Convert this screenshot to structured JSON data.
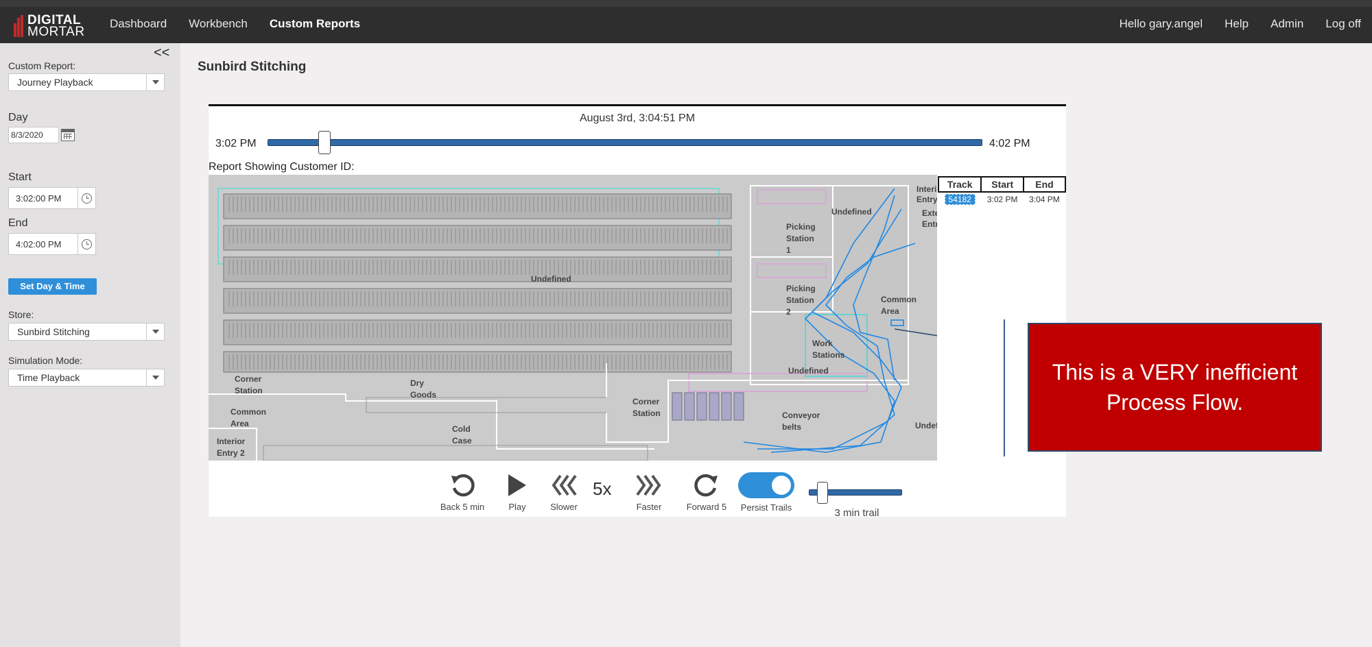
{
  "brand": {
    "line1": "DIGITAL",
    "line2": "MORTAR"
  },
  "nav": {
    "dashboard": "Dashboard",
    "workbench": "Workbench",
    "custom_reports": "Custom Reports"
  },
  "nav_right": {
    "greeting": "Hello gary.angel",
    "help": "Help",
    "admin": "Admin",
    "logoff": "Log off"
  },
  "sidebar": {
    "collapse": "<<",
    "custom_report_label": "Custom Report:",
    "custom_report_value": "Journey Playback",
    "day_label": "Day",
    "day_value": "8/3/2020",
    "start_label": "Start",
    "start_value": "3:02:00 PM",
    "end_label": "End",
    "end_value": "4:02:00 PM",
    "set_button": "Set Day & Time",
    "store_label": "Store:",
    "store_value": "Sunbird Stitching",
    "sim_label": "Simulation Mode:",
    "sim_value": "Time Playback"
  },
  "page": {
    "title": "Sunbird Stitching"
  },
  "timeline": {
    "current": "August 3rd, 3:04:51 PM",
    "start": "3:02 PM",
    "end": "4:02 PM",
    "position": 0.08
  },
  "report_label": "Report Showing Customer ID:",
  "map_labels": {
    "undefined_main": "Undefined",
    "undefined_top": "Undefined",
    "picking1_a": "Picking",
    "picking1_b": "Station",
    "picking1_c": "1",
    "picking2_a": "Picking",
    "picking2_b": "Station",
    "picking2_c": "2",
    "interior_a": "Interior",
    "interior_b": "Entry",
    "exterior_a": "Exterior",
    "exterior_b": "Entry",
    "common_a": "Common",
    "common_b": "Area",
    "work_a": "Work",
    "work_b": "Stations",
    "undefined_work": "Undefined",
    "corner1_a": "Corner",
    "corner1_b": "Station",
    "dry_a": "Dry",
    "dry_b": "Goods",
    "common2_a": "Common",
    "common2_b": "Area",
    "interior2_a": "Interior",
    "interior2_b": "Entry 2",
    "cold_a": "Cold",
    "cold_b": "Case",
    "corner2_a": "Corner",
    "corner2_b": "Station",
    "conveyor_a": "Conveyor",
    "conveyor_b": "belts",
    "undefined_right": "Undefined"
  },
  "track_table": {
    "headers": [
      "Track",
      "Start",
      "End"
    ],
    "rows": [
      {
        "track": "54182",
        "start": "3:02 PM",
        "end": "3:04 PM"
      }
    ]
  },
  "callout": {
    "text": "This is a VERY inefficient Process Flow."
  },
  "controls": {
    "back": "Back 5 min",
    "play": "Play",
    "slower": "Slower",
    "speed": "5x",
    "faster": "Faster",
    "forward": "Forward 5",
    "persist": "Persist Trails",
    "trail": "3 min trail",
    "persist_on": true,
    "trail_position": 0.15
  },
  "colors": {
    "accent": "#2f8fd8",
    "track": "#2f6aa8",
    "callout": "#c00000",
    "path": "#1e88e5"
  }
}
